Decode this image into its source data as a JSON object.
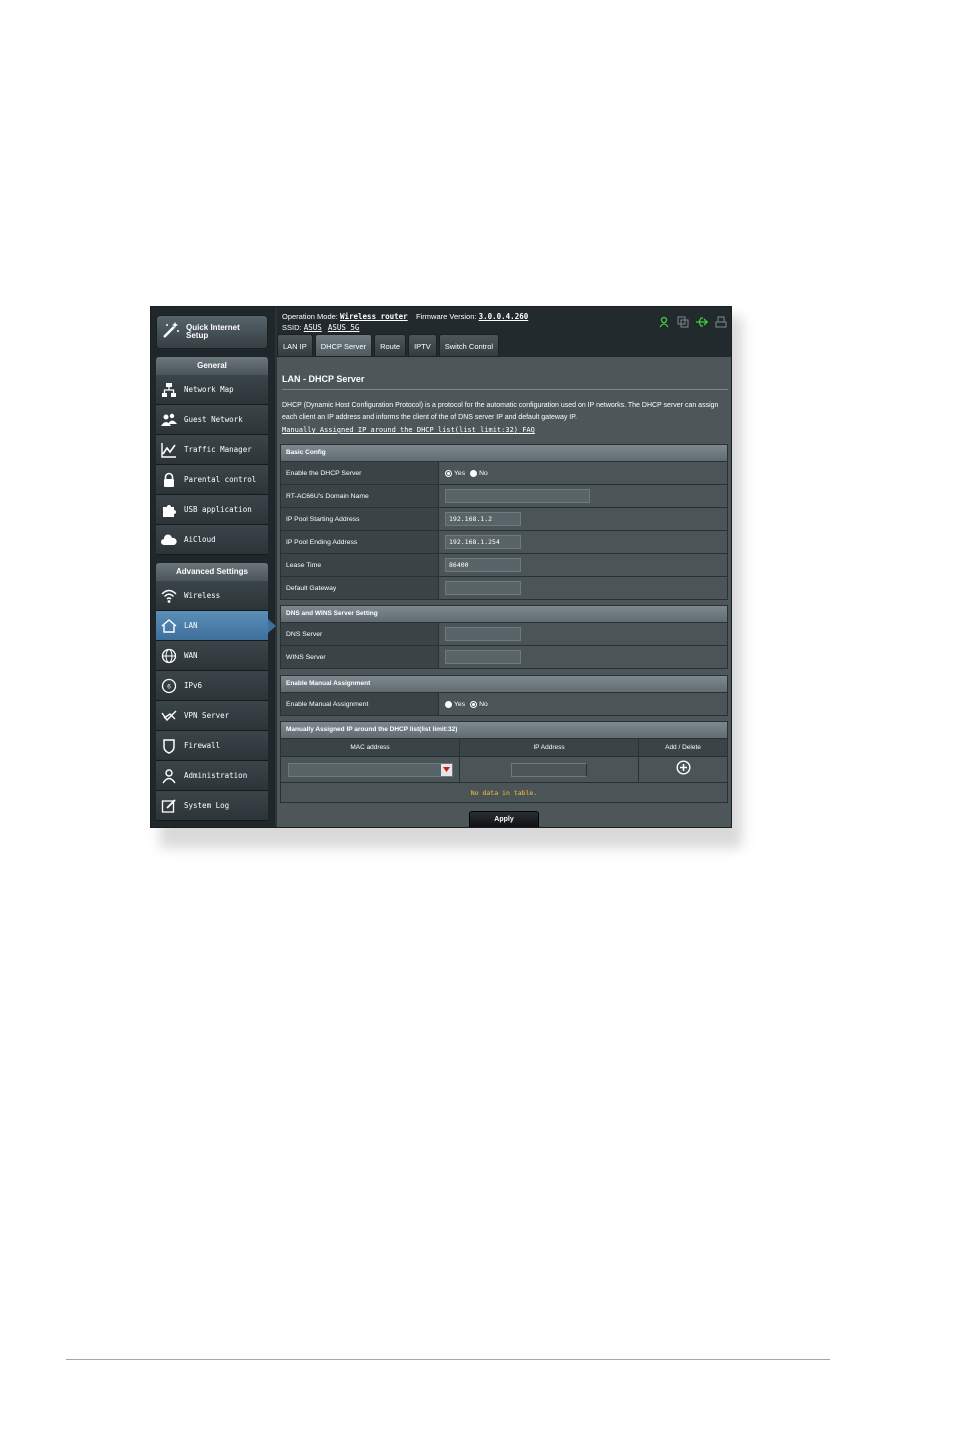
{
  "sidebar": {
    "quick_setup": "Quick Internet Setup",
    "general_header": "General",
    "general_items": [
      {
        "label": "Network Map",
        "icon": "network-map-icon"
      },
      {
        "label": "Guest Network",
        "icon": "guest-network-icon"
      },
      {
        "label": "Traffic Manager",
        "icon": "traffic-manager-icon"
      },
      {
        "label": "Parental control",
        "icon": "lock-icon"
      },
      {
        "label": "USB application",
        "icon": "puzzle-icon"
      },
      {
        "label": "AiCloud",
        "icon": "cloud-icon"
      }
    ],
    "advanced_header": "Advanced Settings",
    "advanced_items": [
      {
        "label": "Wireless",
        "icon": "wifi-icon"
      },
      {
        "label": "LAN",
        "icon": "home-icon",
        "active": true
      },
      {
        "label": "WAN",
        "icon": "globe-icon"
      },
      {
        "label": "IPv6",
        "icon": "ipv6-icon"
      },
      {
        "label": "VPN Server",
        "icon": "vpn-icon"
      },
      {
        "label": "Firewall",
        "icon": "shield-icon"
      },
      {
        "label": "Administration",
        "icon": "user-icon"
      },
      {
        "label": "System Log",
        "icon": "edit-icon"
      }
    ]
  },
  "topbar": {
    "op_mode_label": "Operation Mode:",
    "op_mode_value": "Wireless router",
    "fw_label": "Firmware Version:",
    "fw_value": "3.0.0.4.260",
    "ssid_label": "SSID:",
    "ssid_1": "ASUS",
    "ssid_2": "ASUS_5G"
  },
  "tabs": [
    {
      "label": "LAN IP"
    },
    {
      "label": "DHCP Server",
      "active": true
    },
    {
      "label": "Route"
    },
    {
      "label": "IPTV"
    },
    {
      "label": "Switch Control"
    }
  ],
  "page": {
    "title": "LAN - DHCP Server",
    "description": "DHCP (Dynamic Host Configuration Protocol) is a protocol for the automatic configuration used on IP networks. The DHCP server can assign each client an IP address and informs the client of the of DNS server IP and default gateway IP.",
    "faq_link": "Manually Assigned IP around the DHCP list(list limit:32) FAQ"
  },
  "basic_config": {
    "header": "Basic Config",
    "enable_label": "Enable the DHCP Server",
    "yes": "Yes",
    "no": "No",
    "domain_label": "RT-AC66U's Domain Name",
    "domain_value": "",
    "start_label": "IP Pool Starting Address",
    "start_value": "192.168.1.2",
    "end_label": "IP Pool Ending Address",
    "end_value": "192.168.1.254",
    "lease_label": "Lease Time",
    "lease_value": "86400",
    "gateway_label": "Default Gateway",
    "gateway_value": ""
  },
  "dns_wins": {
    "header": "DNS and WINS Server Setting",
    "dns_label": "DNS Server",
    "dns_value": "",
    "wins_label": "WINS Server",
    "wins_value": ""
  },
  "manual": {
    "header": "Enable Manual Assignment",
    "label": "Enable Manual Assignment",
    "yes": "Yes",
    "no": "No"
  },
  "manual_list": {
    "header": "Manually Assigned IP around the DHCP list(list limit:32)",
    "col_mac": "MAC address",
    "col_ip": "IP Address",
    "col_action": "Add / Delete",
    "empty": "No data in table."
  },
  "apply_label": "Apply",
  "colors": {
    "accent": "#3d6f9a",
    "warning": "#f2c232",
    "status_green": "#38d13c"
  }
}
